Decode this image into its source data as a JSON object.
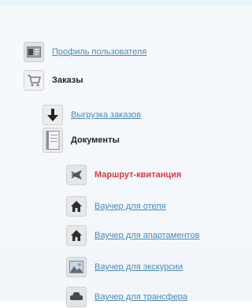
{
  "tree": {
    "profile": "Профиль пользователя",
    "orders": "Заказы",
    "orders_export": "Выгрузка заказов",
    "documents": "Документы",
    "route_receipt": "Маршрут-квитанция",
    "voucher_hotel": "Ваучер для отеля",
    "voucher_apartment": "Ваучер для апартаментов",
    "voucher_excursion": "Ваучер для экскурсии",
    "voucher_transfer": "Ваучер для трансфера"
  },
  "colors": {
    "link": "#4b89b8",
    "active": "#e2343e",
    "heading": "#222222"
  },
  "icons": {
    "profile": "user-card-icon",
    "orders": "cart-icon",
    "orders_export": "download-arrow-icon",
    "documents": "document-icon",
    "route_receipt": "airplane-icon",
    "voucher_hotel": "house-icon",
    "voucher_apartment": "house-icon",
    "voucher_excursion": "landscape-icon",
    "voucher_transfer": "car-icon"
  }
}
